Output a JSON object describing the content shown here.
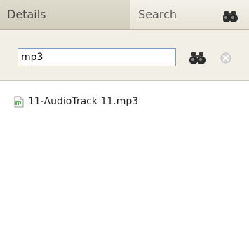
{
  "tabs": {
    "details_label": "Details",
    "search_label": "Search"
  },
  "search": {
    "query": "mp3"
  },
  "results": [
    {
      "label": "11-AudioTrack 11.mp3",
      "icon": "audio-file-icon"
    }
  ],
  "colors": {
    "tab_bar": "#e7e3d6",
    "search_area": "#f1efe6",
    "input_border": "#7f9db9",
    "audio_icon_accent": "#2e9b2e"
  }
}
